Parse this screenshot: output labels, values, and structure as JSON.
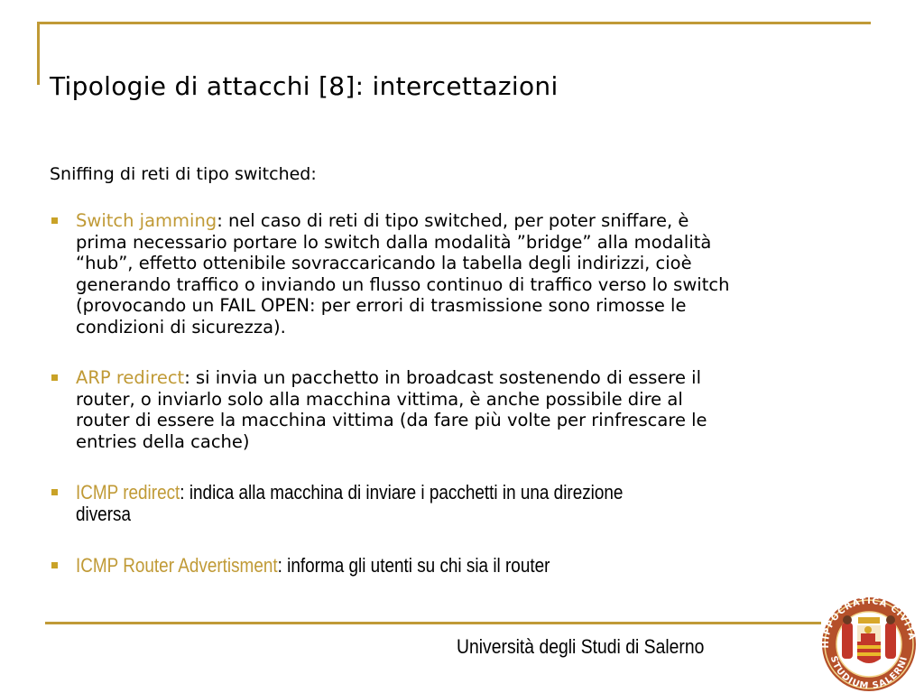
{
  "slide": {
    "title": "Tipologie di attacchi [8]: intercettazioni",
    "intro": "Sniffing di reti di tipo switched:",
    "bullets": [
      {
        "term": "Switch jamming",
        "lines": [
          ": nel caso di reti di tipo switched, per poter sniffare, è",
          "prima necessario portare lo switch dalla modalità ”bridge” alla modalità",
          "“hub”, effetto ottenibile sovraccaricando la tabella degli indirizzi, cioè",
          "generando traffico o inviando un flusso continuo di traffico verso lo switch",
          "(provocando un FAIL OPEN: per errori di trasmissione sono rimosse le",
          "condizioni di sicurezza)."
        ]
      },
      {
        "term": "ARP redirect",
        "lines": [
          ": si invia un pacchetto in broadcast sostenendo di essere il",
          "router, o inviarlo solo alla macchina vittima, è anche possibile dire al",
          "router di essere la macchina vittima (da fare più volte per rinfrescare le",
          "entries della cache)"
        ]
      },
      {
        "term": "ICMP redirect",
        "lines": [
          ": indica alla macchina di inviare i pacchetti in una direzione",
          "diversa"
        ]
      },
      {
        "term": "ICMP Router Advertisment",
        "lines": [
          ": informa gli utenti su chi sia il router"
        ]
      }
    ]
  },
  "footer": {
    "institution": "Università degli Studi di Salerno",
    "seal_top_text": "HIPPOCRATICA CIVITAS",
    "seal_bottom_text": "STUDIUM SALERNI"
  },
  "colors": {
    "accent": "#c09a36",
    "text": "#000000",
    "background": "#ffffff"
  }
}
